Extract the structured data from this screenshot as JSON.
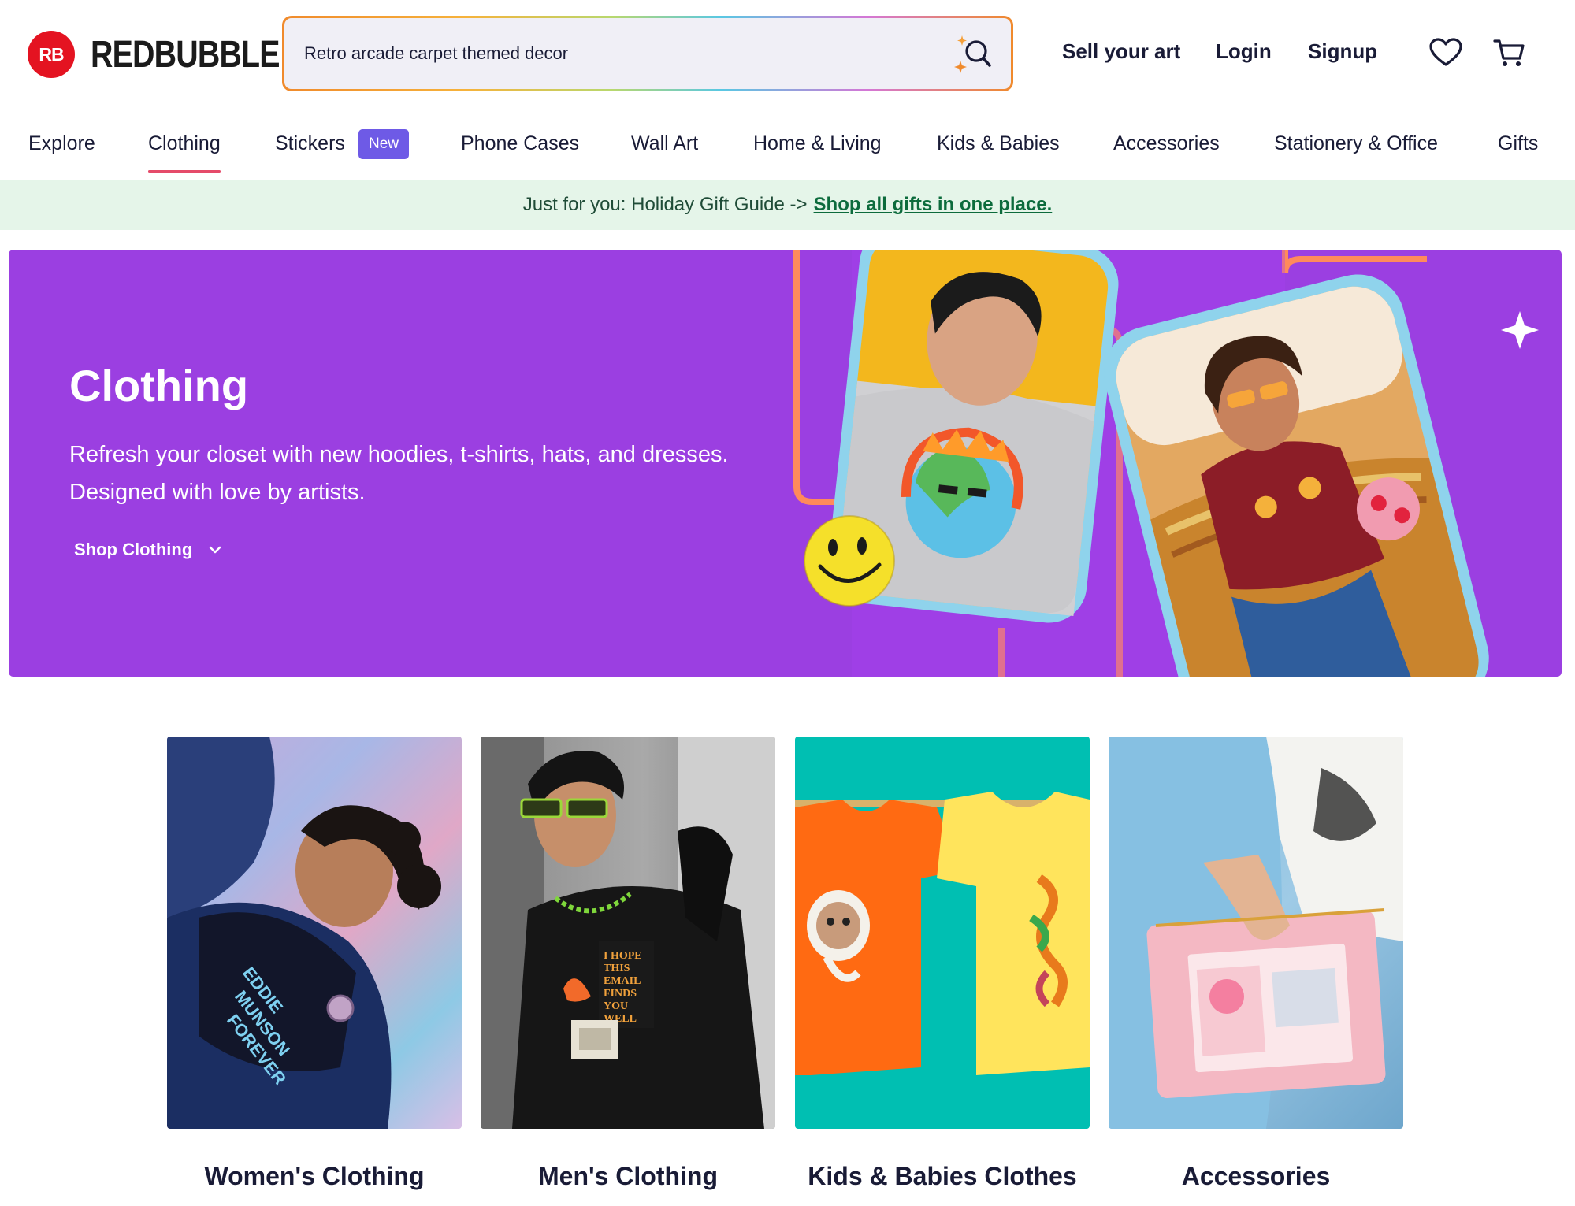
{
  "brand": {
    "logo_mark": "RB",
    "name": "REDBUBBLE",
    "color": "#e41321"
  },
  "search": {
    "value": "Retro arcade carpet themed decor",
    "icon": "sparkle-search-icon"
  },
  "header_links": {
    "sell": "Sell your art",
    "login": "Login",
    "signup": "Signup",
    "wishlist_icon": "heart-icon",
    "cart_icon": "cart-icon"
  },
  "nav": {
    "items": [
      "Explore",
      "Clothing",
      "Stickers",
      "Phone Cases",
      "Wall Art",
      "Home & Living",
      "Kids & Babies",
      "Accessories",
      "Stationery & Office",
      "Gifts"
    ],
    "active": "Clothing",
    "new_badge": "New"
  },
  "promo": {
    "text": "Just for you: Holiday Gift Guide ->",
    "link": "Shop all gifts in one place."
  },
  "hero": {
    "title": "Clothing",
    "description": "Refresh your closet with new hoodies, t-shirts, hats, and dresses. Designed with love by artists.",
    "cta": "Shop Clothing",
    "background": "#9b3fe1"
  },
  "categories": [
    {
      "label": "Women's Clothing",
      "shirt_text": "EDDIE MUNSON FOREVER"
    },
    {
      "label": "Men's Clothing",
      "shirt_text": "I HOPE THIS EMAIL FINDS YOU WELL"
    },
    {
      "label": "Kids & Babies Clothes"
    },
    {
      "label": "Accessories"
    }
  ]
}
